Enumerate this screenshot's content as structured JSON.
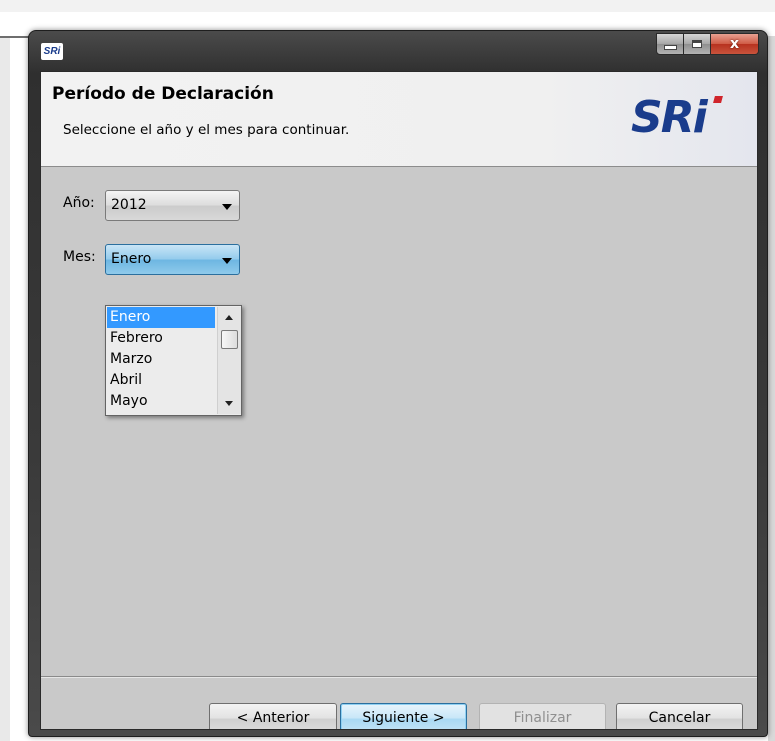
{
  "window": {
    "icon_text": "SRi",
    "caption_buttons": {
      "minimize": "minimize",
      "maximize": "maximize",
      "close": "x"
    }
  },
  "header": {
    "title": "Período de Declaración",
    "subtitle": "Seleccione el año y el mes para continuar.",
    "logo_text": "SRi"
  },
  "form": {
    "year_label": "Año:",
    "year_value": "2012",
    "month_label": "Mes:",
    "month_value": "Enero"
  },
  "month_dropdown": {
    "options": [
      "Enero",
      "Febrero",
      "Marzo",
      "Abril",
      "Mayo"
    ],
    "selected": "Enero"
  },
  "buttons": {
    "previous": "< Anterior",
    "next": "Siguiente >",
    "finish": "Finalizar",
    "cancel": "Cancelar"
  },
  "colors": {
    "selection": "#3399ff",
    "logo_blue": "#1a3c8c",
    "logo_red": "#d0252b"
  }
}
